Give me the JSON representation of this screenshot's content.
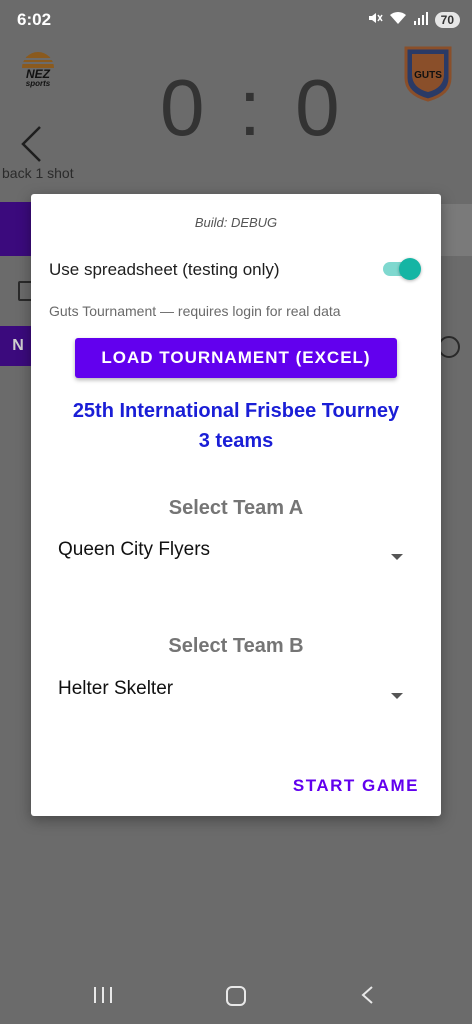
{
  "status": {
    "time": "6:02",
    "battery": "70"
  },
  "background": {
    "score": "0 : 0",
    "back_label": "back 1 shot",
    "nez_logo_text": "NEZ sports",
    "guts_logo_text": "GUTS",
    "n_button": "N"
  },
  "dialog": {
    "build": "Build: DEBUG",
    "spreadsheet_label": "Use spreadsheet (testing only)",
    "spreadsheet_on": true,
    "note": "Guts Tournament — requires login for real data",
    "load_button": "LOAD TOURNAMENT (EXCEL)",
    "tourney_name": "25th International Frisbee Tourney",
    "team_count": "3 teams",
    "team_a_heading": "Select Team A",
    "team_a_value": "Queen City Flyers",
    "team_b_heading": "Select Team B",
    "team_b_value": "Helter Skelter",
    "start_button": "START GAME"
  },
  "colors": {
    "accent": "#6200ee",
    "tourney_text": "#1a1ed6",
    "switch_on": "#15b5a4",
    "scrim": "#6b6b6b"
  }
}
